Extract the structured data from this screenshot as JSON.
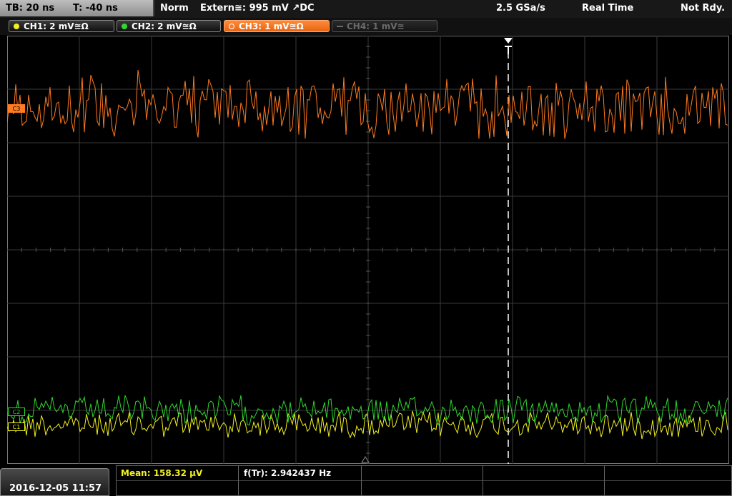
{
  "topbar": {
    "timebase": "TB: 20 ns",
    "trigger_offset": "T: -40 ns",
    "mode": "Norm",
    "trigger_source": "Extern≅: 995 mV ↗DC",
    "sample_rate": "2.5 GSa/s",
    "acquisition": "Real Time",
    "status": "Not Rdy."
  },
  "channels": [
    {
      "label": "CH1: 2 mV≅Ω",
      "color": "#f2f21e",
      "state": "on"
    },
    {
      "label": "CH2: 2 mV≅Ω",
      "color": "#2ed82e",
      "state": "on"
    },
    {
      "label": "CH3: 1 mV≅Ω",
      "color": "#ff7a20",
      "state": "selected"
    },
    {
      "label": "CH4: 1 mV≅",
      "color": "#6a6a6a",
      "state": "off"
    }
  ],
  "markers": {
    "trigger": "T",
    "ch3": "C3",
    "ch2": "C2",
    "ch1": "C1"
  },
  "footer": {
    "datetime": "2016-12-05 11:57",
    "measurements": [
      {
        "label": "Mean: 158.32 µV",
        "color": "#f2f21e"
      },
      {
        "label": "f(Tr): 2.942437 Hz",
        "color": "#ffffff"
      }
    ]
  },
  "colors": {
    "ch1": "#f2f21e",
    "ch2": "#2ed82e",
    "ch3": "#ff7a20",
    "grid": "#3a3a3a"
  }
}
